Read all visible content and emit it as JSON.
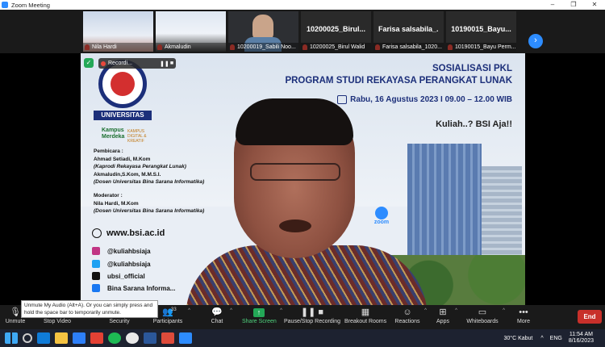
{
  "window": {
    "title": "Zoom Meeting",
    "controls": [
      "–",
      "❐",
      "✕"
    ]
  },
  "participants": [
    {
      "name": "Nila Hardi",
      "big_name": ""
    },
    {
      "name": "Akmaludin",
      "big_name": ""
    },
    {
      "name": "10200019_Sabili Noo...",
      "big_name": ""
    },
    {
      "name": "10200025_Birul Walid",
      "big_name": "10200025_Birul..."
    },
    {
      "name": "Farisa salsabila_1020...",
      "big_name": "Farisa salsabila_..."
    },
    {
      "name": "10190015_Bayu Perm...",
      "big_name": "10190015_Bayu..."
    }
  ],
  "next_page_icon": "chevron-right-icon",
  "recording": {
    "label": "Recordi..."
  },
  "slide": {
    "logo_text": "UNIVERSITAS",
    "merdeka": "Kampus Merdeka",
    "kampus": "KAMPUS DIGITAL & KREATIF",
    "title_line1": "SOSIALISASI PKL",
    "title_line2": "PROGRAM STUDI REKAYASA PERANGKAT LUNAK",
    "date": "Rabu, 16 Agustus 2023 I 09.00 – 12.00 WIB",
    "tagline": "Kuliah..? BSI Aja!!",
    "speakers_label": "Pembicara :",
    "speaker1_name": "Ahmad Setiadi, M.Kom",
    "speaker1_role": "(Kaprodi Rekayasa Perangkat Lunak)",
    "speaker2_name": "Akmaludin,S.Kom, M.M.S.I.",
    "speaker2_role": "(Dosen Universitas Bina Sarana Informatika)",
    "moderator_label": "Moderator :",
    "moderator_name": "Nila Hardi, M.Kom",
    "moderator_role": "(Dosen Universitas Bina Sarana Informatika)",
    "website": "www.bsi.ac.id",
    "instagram": "@kuliahbsiaja",
    "twitter": "@kuliahbsiaja",
    "tiktok": "ubsi_official",
    "facebook": "Bina Sarana Informa...",
    "zoom_word": "zoom",
    "building_sign": "UNIVERSITAS"
  },
  "tooltip": "Unmute My Audio (Alt+A). Or you can simply press and hold the space bar to temporarily unmute.",
  "toolbar": {
    "unmute": "Unmute",
    "stop_video": "Stop Video",
    "security": "Security",
    "participants": "Participants",
    "participants_count": "33",
    "chat": "Chat",
    "share_screen": "Share Screen",
    "pause_recording": "Pause/Stop Recording",
    "breakout_rooms": "Breakout Rooms",
    "reactions": "Reactions",
    "apps": "Apps",
    "whiteboards": "Whiteboards",
    "more": "More",
    "end": "End"
  },
  "taskbar": {
    "weather": "30°C  Kabut",
    "language": "ENG",
    "time": "11:54 AM",
    "date": "8/16/2023"
  }
}
